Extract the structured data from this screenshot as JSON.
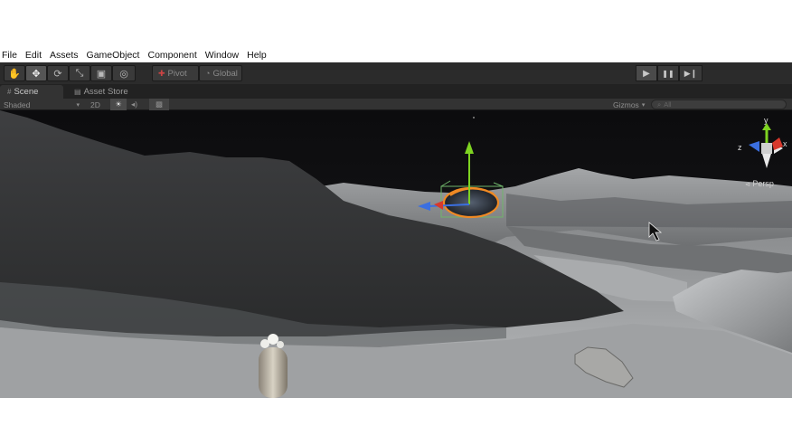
{
  "menu": {
    "items": [
      "File",
      "Edit",
      "Assets",
      "GameObject",
      "Component",
      "Window",
      "Help"
    ]
  },
  "toolbar": {
    "tools": [
      {
        "icon": "hand-icon",
        "glyph": "✋"
      },
      {
        "icon": "move-icon",
        "glyph": "✥"
      },
      {
        "icon": "rotate-icon",
        "glyph": "⟳"
      },
      {
        "icon": "scale-icon",
        "glyph": "⤡"
      },
      {
        "icon": "rect-icon",
        "glyph": "▣"
      },
      {
        "icon": "transform-icon",
        "glyph": "◎"
      }
    ],
    "pivot_label": "Pivot",
    "global_label": "Global",
    "play_glyph": "▶",
    "pause_glyph": "❚❚",
    "step_glyph": "▶❙"
  },
  "tabs": {
    "scene_label": "Scene",
    "asset_store_label": "Asset Store",
    "scene_icon": "#",
    "asset_store_icon": "▤"
  },
  "scene_options": {
    "shading": "Shaded",
    "mode_2d": "2D",
    "lighting_glyph": "☀",
    "audio_glyph": "◂)",
    "effects_glyph": "▩",
    "gizmos_label": "Gizmos",
    "search_placeholder": "All",
    "persp_label": "Persp"
  },
  "gizmo": {
    "y_label": "y",
    "x_label": "x",
    "z_label": "z"
  },
  "colors": {
    "toolbar_bg": "#2b2b2b",
    "selection_outline": "#f08a24",
    "axis_y": "#7ed321",
    "axis_z": "#3b6fe0",
    "axis_x": "#d8382c"
  }
}
